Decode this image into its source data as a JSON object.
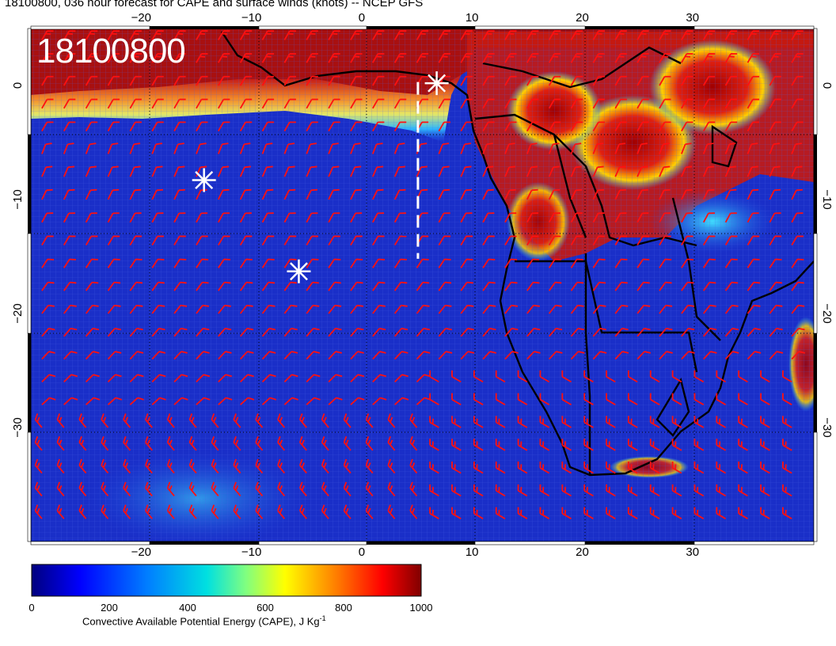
{
  "title": "18100800, 036 hour forecast for CAPE and surface winds (knots) -- NCEP GFS",
  "stamp": "18100800",
  "colorbar": {
    "label": "Convective Available Potential Energy (CAPE), J Kg",
    "label_sup": "-1",
    "ticks": [
      "0",
      "200",
      "400",
      "600",
      "800",
      "1000"
    ],
    "colors": [
      "#00007f",
      "#0000ff",
      "#0080ff",
      "#00e0e0",
      "#80ff80",
      "#ffff00",
      "#ff8000",
      "#ff0000",
      "#800000"
    ]
  },
  "axes": {
    "lon_labels": [
      "−20",
      "−10",
      "0",
      "10",
      "20",
      "30"
    ],
    "lat_labels": [
      "0",
      "−10",
      "−20",
      "−30"
    ],
    "lon_range": [
      -30,
      41
    ],
    "lat_range": [
      -40,
      5
    ]
  },
  "colors": {
    "ocean": "#1a2fc8",
    "land_low": "#1e3fe0",
    "high_cape": "#b01010",
    "barb": "#ff1010",
    "coast": "#000000",
    "marker": "#ffffff"
  },
  "markers": [
    {
      "name": "asterisk-1",
      "lon": 6.8,
      "lat": 0.2
    },
    {
      "name": "asterisk-2",
      "lon": -14.3,
      "lat": -8.3
    },
    {
      "name": "asterisk-3",
      "lon": -5.7,
      "lat": -16.3
    }
  ],
  "dashed_line": {
    "lon": 5.1,
    "lat_from": 0.3,
    "lat_to": -15.2
  }
}
